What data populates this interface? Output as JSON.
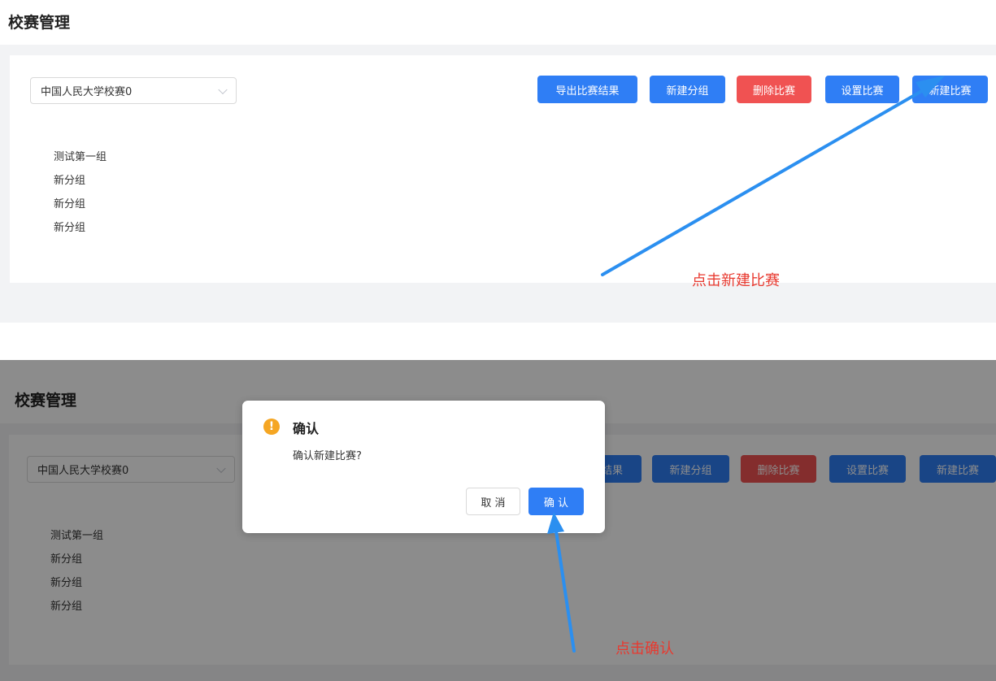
{
  "page": {
    "title": "校赛管理",
    "school_select": "中国人民大学校赛0",
    "buttons": {
      "export_results": "导出比赛结果",
      "new_group": "新建分组",
      "delete_contest": "删除比赛",
      "settings_contest": "设置比赛",
      "new_contest": "新建比赛"
    },
    "groups": [
      "测试第一组",
      "新分组",
      "新分组",
      "新分组"
    ]
  },
  "annotations": {
    "step1": "点击新建比赛",
    "step2": "点击确认"
  },
  "dialog": {
    "icon": "warning-icon",
    "title": "确认",
    "message": "确认新建比赛?",
    "cancel_label": "取 消",
    "confirm_label": "确 认"
  },
  "colors": {
    "primary": "#2f7ef5",
    "danger": "#f05252",
    "warning": "#f5a623",
    "annotation_text": "#e8392f",
    "annotation_arrow": "#2b8ff0"
  }
}
